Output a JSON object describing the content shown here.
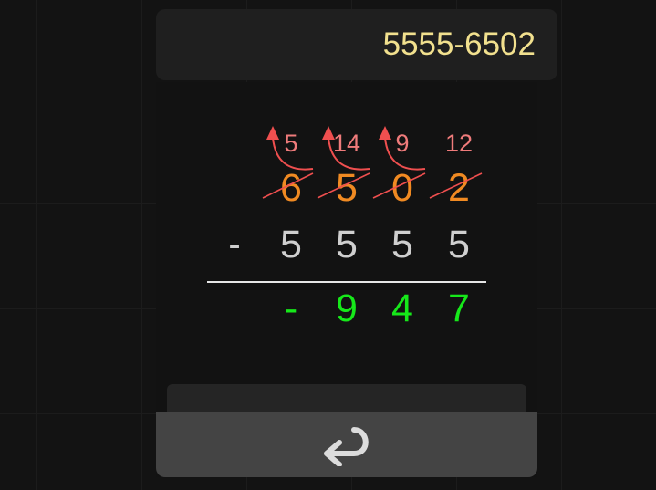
{
  "display": {
    "expression": "5555-6502"
  },
  "problem": {
    "operator": "-",
    "borrow_marks": [
      "5",
      "14",
      "9",
      "12"
    ],
    "top_digits": [
      "6",
      "5",
      "0",
      "2"
    ],
    "subtrahend_digits": [
      "5",
      "5",
      "5",
      "5"
    ],
    "result_digits": [
      "-",
      "9",
      "4",
      "7"
    ]
  },
  "colors": {
    "display_text": "#f1e08e",
    "borrow": "#ef7b7b",
    "arrows": "#ef4f4f",
    "top_digits": "#f08a22",
    "subtrahend": "#cfcfcf",
    "result": "#16e81a"
  },
  "controls": {
    "enter_icon": "return-arrow-icon"
  }
}
